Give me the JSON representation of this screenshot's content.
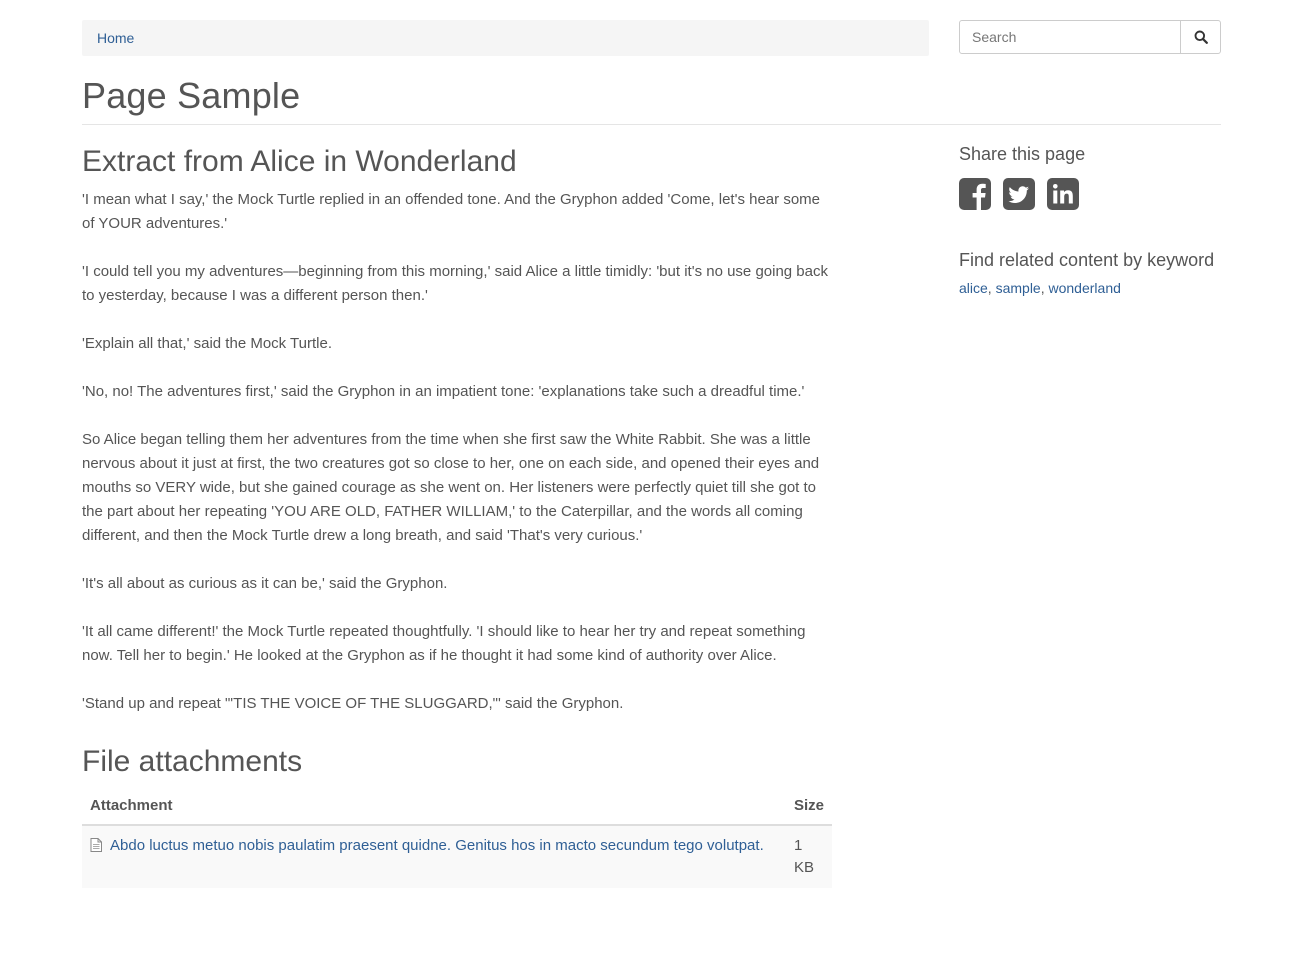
{
  "breadcrumb": {
    "home": "Home"
  },
  "search": {
    "placeholder": "Search"
  },
  "page": {
    "title": "Page Sample"
  },
  "article": {
    "heading": "Extract from Alice in Wonderland",
    "paragraphs": [
      "'I mean what I say,' the Mock Turtle replied in an offended tone. And the Gryphon added 'Come, let's hear some of YOUR adventures.'",
      "'I could tell you my adventures—beginning from this morning,' said Alice a little timidly: 'but it's no use going back to yesterday, because I was a different person then.'",
      "'Explain all that,' said the Mock Turtle.",
      "'No, no! The adventures first,' said the Gryphon in an impatient tone: 'explanations take such a dreadful time.'",
      "So Alice began telling them her adventures from the time when she first saw the White Rabbit. She was a little nervous about it just at first, the two creatures got so close to her, one on each side, and opened their eyes and mouths so VERY wide, but she gained courage as she went on. Her listeners were perfectly quiet till she got to the part about her repeating 'YOU ARE OLD, FATHER WILLIAM,' to the Caterpillar, and the words all coming different, and then the Mock Turtle drew a long breath, and said 'That's very curious.'",
      "'It's all about as curious as it can be,' said the Gryphon.",
      "'It all came different!' the Mock Turtle repeated thoughtfully. 'I should like to hear her try and repeat something now. Tell her to begin.' He looked at the Gryphon as if he thought it had some kind of authority over Alice.",
      "'Stand up and repeat \"'TIS THE VOICE OF THE SLUGGARD,\"' said the Gryphon."
    ]
  },
  "attachments": {
    "heading": "File attachments",
    "columns": [
      "Attachment",
      "Size"
    ],
    "rows": [
      {
        "name": "Abdo luctus metuo nobis paulatim praesent quidne. Genitus hos in macto secundum tego volutpat.",
        "size": "1 KB"
      }
    ]
  },
  "sidebar": {
    "share_heading": "Share this page",
    "social_icons": [
      "facebook-icon",
      "twitter-icon",
      "linkedin-icon"
    ],
    "keywords_heading": "Find related content by keyword",
    "keywords": [
      "alice",
      "sample",
      "wonderland"
    ],
    "keyword_separator": ", "
  },
  "colors": {
    "link": "#2f5f95",
    "text": "#555555",
    "icon": "#555555",
    "breadcrumb_bg": "#f5f5f5"
  }
}
